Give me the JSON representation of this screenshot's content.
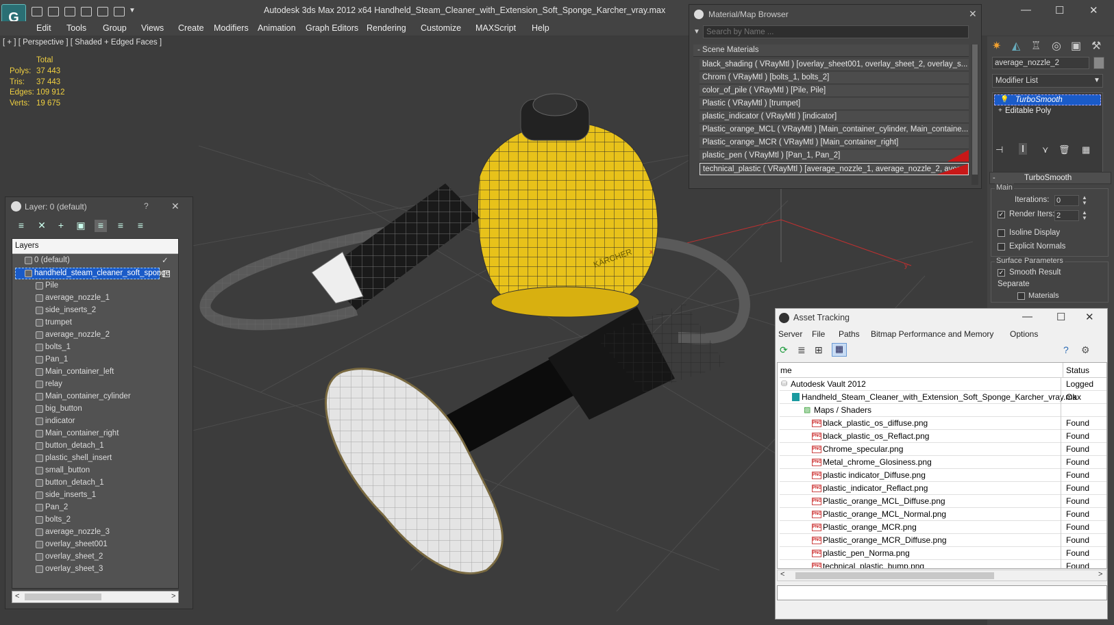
{
  "app": {
    "title": "Autodesk 3ds Max  2012 x64      Handheld_Steam_Cleaner_with_Extension_Soft_Sponge_Karcher_vray.max",
    "logo": "G",
    "menu": [
      "Edit",
      "Tools",
      "Group",
      "Views",
      "Create",
      "Modifiers",
      "Animation",
      "Graph Editors",
      "Rendering",
      "Customize",
      "MAXScript",
      "Help"
    ]
  },
  "viewport": {
    "label": "[ + ] [ Perspective ] [ Shaded + Edged Faces ]",
    "stats": {
      "header": "Total",
      "rows": [
        {
          "label": "Polys:",
          "value": "37 443"
        },
        {
          "label": "Tris:",
          "value": "37 443"
        },
        {
          "label": "Edges:",
          "value": "109 912"
        },
        {
          "label": "Verts:",
          "value": "19 675"
        }
      ]
    },
    "logo_text": "KÄRCHER",
    "axis_x": "x",
    "axis_y": "y"
  },
  "layer_panel": {
    "title": "Layer: 0 (default)",
    "help": "?",
    "close": "✕",
    "column": "Layers",
    "default_layer": "0 (default)",
    "selected_layer": "handheld_steam_cleaner_soft_sponge",
    "objects": [
      "Pile",
      "average_nozzle_1",
      "side_inserts_2",
      "trumpet",
      "average_nozzle_2",
      "bolts_1",
      "Pan_1",
      "Main_container_left",
      "relay",
      "Main_container_cylinder",
      "big_button",
      "indicator",
      "Main_container_right",
      "button_detach_1",
      "plastic_shell_insert",
      "small_button",
      "button_detach_1",
      "side_inserts_1",
      "Pan_2",
      "bolts_2",
      "average_nozzle_3",
      "overlay_sheet001",
      "overlay_sheet_2",
      "overlay_sheet_3"
    ]
  },
  "material_browser": {
    "title": "Material/Map Browser",
    "search_placeholder": "Search by Name ...",
    "section": "- Scene Materials",
    "materials": [
      "black_shading  ( VRayMtl ) [overlay_sheet001, overlay_sheet_2, overlay_s...",
      "Chrom  ( VRayMtl ) [bolts_1, bolts_2]",
      "color_of_pile  ( VRayMtl ) [Pile, Pile]",
      "Plastic  ( VRayMtl ) [trumpet]",
      "plastic_indicator  ( VRayMtl ) [indicator]",
      "Plastic_orange_MCL  ( VRayMtl ) [Main_container_cylinder, Main_containe...",
      "Plastic_orange_MCR  ( VRayMtl ) [Main_container_right]",
      "plastic_pen  ( VRayMtl ) [Pan_1, Pan_2]",
      "technical_plastic  ( VRayMtl ) [average_nozzle_1, average_nozzle_2, avera..."
    ]
  },
  "command_panel": {
    "object_name": "average_nozzle_2",
    "modifier_list": "Modifier List",
    "stack": [
      "TurboSmooth",
      "Editable Poly"
    ],
    "rollout_title": "TurboSmooth",
    "main_group": "Main",
    "iterations_label": "Iterations:",
    "iterations_value": "0",
    "render_iters_label": "Render Iters:",
    "render_iters_value": "2",
    "isoline": "Isoline Display",
    "explicit": "Explicit Normals",
    "surface_group": "Surface Parameters",
    "smooth_result": "Smooth Result",
    "separate": "Separate",
    "materials": "Materials"
  },
  "asset_tracking": {
    "title": "Asset Tracking",
    "menu": [
      "Server",
      "File",
      "Paths",
      "Bitmap Performance and Memory",
      "Options"
    ],
    "col_name": "me",
    "col_status": "Status",
    "vault": {
      "name": "Autodesk Vault 2012",
      "status": "Logged"
    },
    "file": {
      "name": "Handheld_Steam_Cleaner_with_Extension_Soft_Sponge_Karcher_vray.max",
      "status": "Ok"
    },
    "group": "Maps / Shaders",
    "png_label": "PNG",
    "maps": [
      {
        "name": "black_plastic_os_diffuse.png",
        "status": "Found"
      },
      {
        "name": "black_plastic_os_Reflact.png",
        "status": "Found"
      },
      {
        "name": "Chrome_specular.png",
        "status": "Found"
      },
      {
        "name": "Metal_chrome_Glosiness.png",
        "status": "Found"
      },
      {
        "name": "plastic indicator_Diffuse.png",
        "status": "Found"
      },
      {
        "name": "plastic_indicator_Reflact.png",
        "status": "Found"
      },
      {
        "name": "Plastic_orange_MCL_Diffuse.png",
        "status": "Found"
      },
      {
        "name": "Plastic_orange_MCL_Normal.png",
        "status": "Found"
      },
      {
        "name": "Plastic_orange_MCR.png",
        "status": "Found"
      },
      {
        "name": "Plastic_orange_MCR_Diffuse.png",
        "status": "Found"
      },
      {
        "name": "plastic_pen_Norma.png",
        "status": "Found"
      },
      {
        "name": "technical_plastic_bump.png",
        "status": "Found"
      }
    ]
  },
  "colors": {
    "body_yellow": "#e8c21a",
    "selection_blue": "#1a5bc8",
    "stats_yellow": "#f0d040"
  }
}
